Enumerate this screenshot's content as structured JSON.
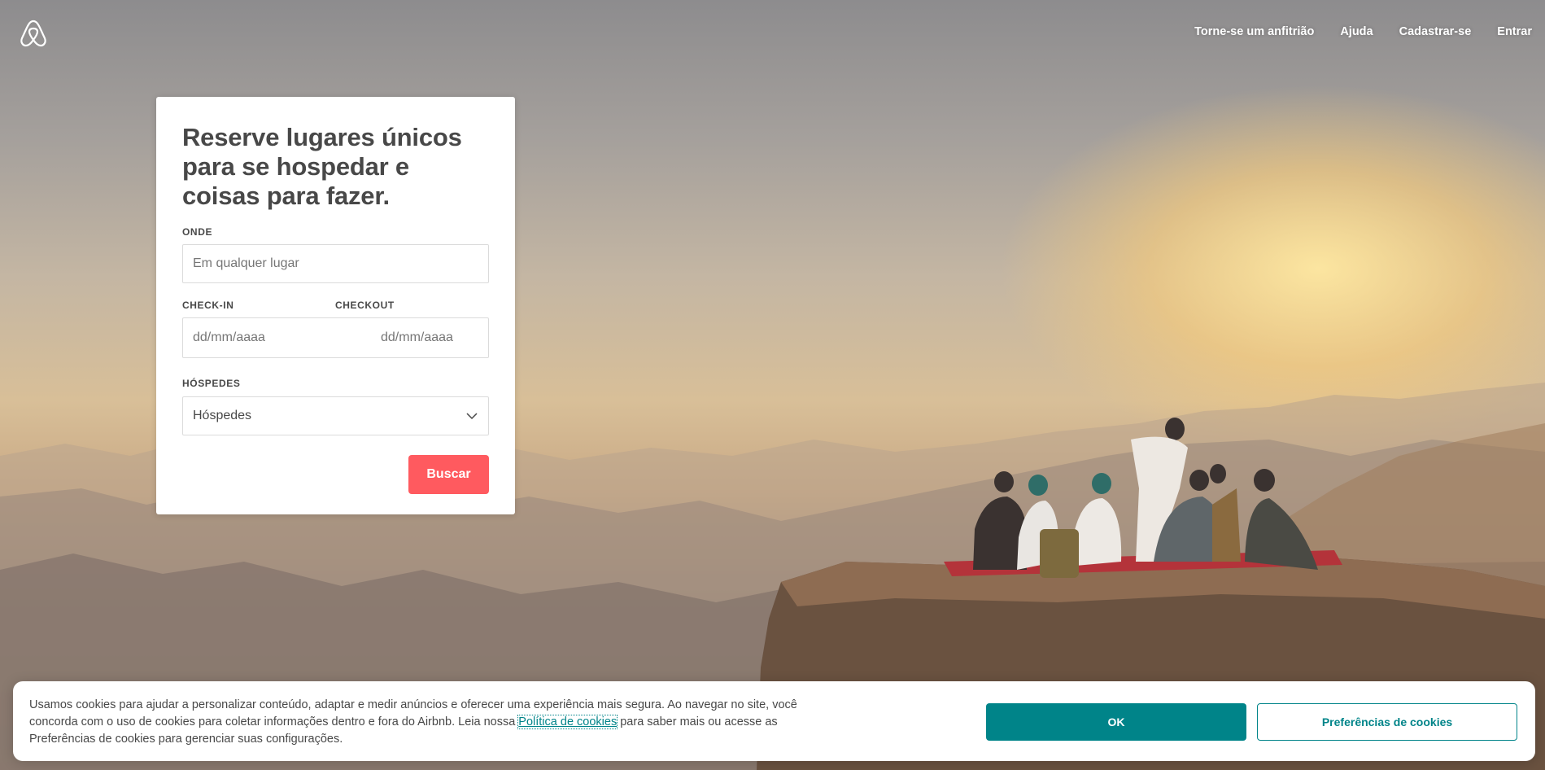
{
  "header": {
    "nav": [
      {
        "label": "Torne-se um anfitrião"
      },
      {
        "label": "Ajuda"
      },
      {
        "label": "Cadastrar-se"
      },
      {
        "label": "Entrar"
      }
    ]
  },
  "search": {
    "title": "Reserve lugares únicos para se hospedar e coisas para fazer.",
    "where_label": "ONDE",
    "where_placeholder": "Em qualquer lugar",
    "checkin_label": "CHECK-IN",
    "checkin_placeholder": "dd/mm/aaaa",
    "checkout_label": "CHECKOUT",
    "checkout_placeholder": "dd/mm/aaaa",
    "guests_label": "HÓSPEDES",
    "guests_value": "Hóspedes",
    "search_button": "Buscar"
  },
  "cookie": {
    "text_before": "Usamos cookies para ajudar a personalizar conteúdo, adaptar e medir anúncios e oferecer uma experiência mais segura. Ao navegar no site, você concorda com o uso de cookies para coletar informações dentro e fora do Airbnb. Leia nossa ",
    "link": "Política de cookies",
    "text_after": " para saber mais ou acesse as Preferências de cookies para gerenciar suas configurações.",
    "ok_button": "OK",
    "prefs_button": "Preferências de cookies"
  },
  "colors": {
    "brand": "#ff5a5f",
    "accent": "#008489",
    "text": "#484848"
  },
  "icons": {
    "logo": "airbnb-logo-icon",
    "guests_dropdown": "chevron-down-icon"
  }
}
